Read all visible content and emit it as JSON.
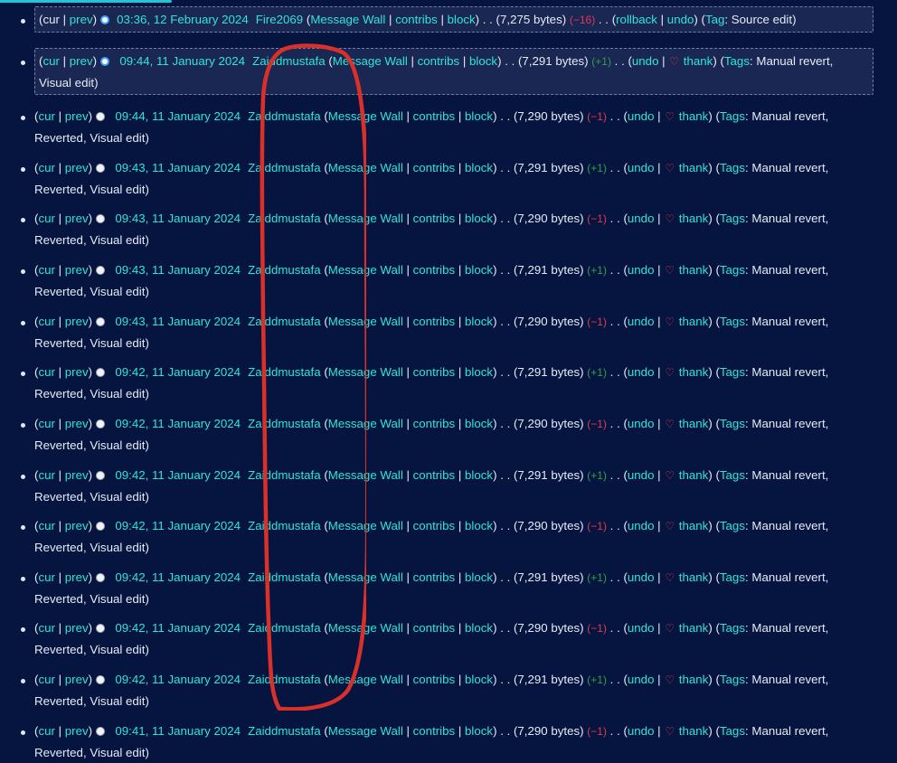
{
  "labels": {
    "cur": "cur",
    "prev": "prev",
    "message_wall": "Message Wall",
    "contribs": "contribs",
    "block": "block",
    "rollback": "rollback",
    "undo": "undo",
    "thank": "thank",
    "tag": "Tag",
    "tags": "Tags",
    "heart_icon": "heart-icon"
  },
  "history": [
    {
      "cur_link": false,
      "prev_link": true,
      "radio_selected": true,
      "timestamp": "03:36, 12 February 2024",
      "user": "Fire2069",
      "bytes": "(7,275 bytes)",
      "diff": "(−16)",
      "diff_sign": "neg",
      "rollback": true,
      "thank": false,
      "tag_label": "Tag",
      "tags": "Source edit",
      "boxed": true
    },
    {
      "cur_link": true,
      "prev_link": true,
      "radio_selected": true,
      "timestamp": "09:44, 11 January 2024",
      "user": "Zaiddmustafa",
      "bytes": "(7,291 bytes)",
      "diff": "(+1)",
      "diff_sign": "pos",
      "rollback": false,
      "thank": true,
      "tag_label": "Tags",
      "tags": "Manual revert, Visual edit",
      "boxed": true
    },
    {
      "cur_link": true,
      "prev_link": true,
      "radio_selected": false,
      "timestamp": "09:44, 11 January 2024",
      "user": "Zaiddmustafa",
      "bytes": "(7,290 bytes)",
      "diff": "(−1)",
      "diff_sign": "neg",
      "rollback": false,
      "thank": true,
      "tag_label": "Tags",
      "tags": "Manual revert, Reverted, Visual edit",
      "boxed": false
    },
    {
      "cur_link": true,
      "prev_link": true,
      "radio_selected": false,
      "timestamp": "09:43, 11 January 2024",
      "user": "Zaiddmustafa",
      "bytes": "(7,291 bytes)",
      "diff": "(+1)",
      "diff_sign": "pos",
      "rollback": false,
      "thank": true,
      "tag_label": "Tags",
      "tags": "Manual revert, Reverted, Visual edit",
      "boxed": false
    },
    {
      "cur_link": true,
      "prev_link": true,
      "radio_selected": false,
      "timestamp": "09:43, 11 January 2024",
      "user": "Zaiddmustafa",
      "bytes": "(7,290 bytes)",
      "diff": "(−1)",
      "diff_sign": "neg",
      "rollback": false,
      "thank": true,
      "tag_label": "Tags",
      "tags": "Manual revert, Reverted, Visual edit",
      "boxed": false
    },
    {
      "cur_link": true,
      "prev_link": true,
      "radio_selected": false,
      "timestamp": "09:43, 11 January 2024",
      "user": "Zaiddmustafa",
      "bytes": "(7,291 bytes)",
      "diff": "(+1)",
      "diff_sign": "pos",
      "rollback": false,
      "thank": true,
      "tag_label": "Tags",
      "tags": "Manual revert, Reverted, Visual edit",
      "boxed": false
    },
    {
      "cur_link": true,
      "prev_link": true,
      "radio_selected": false,
      "timestamp": "09:43, 11 January 2024",
      "user": "Zaiddmustafa",
      "bytes": "(7,290 bytes)",
      "diff": "(−1)",
      "diff_sign": "neg",
      "rollback": false,
      "thank": true,
      "tag_label": "Tags",
      "tags": "Manual revert, Reverted, Visual edit",
      "boxed": false
    },
    {
      "cur_link": true,
      "prev_link": true,
      "radio_selected": false,
      "timestamp": "09:42, 11 January 2024",
      "user": "Zaiddmustafa",
      "bytes": "(7,291 bytes)",
      "diff": "(+1)",
      "diff_sign": "pos",
      "rollback": false,
      "thank": true,
      "tag_label": "Tags",
      "tags": "Manual revert, Reverted, Visual edit",
      "boxed": false
    },
    {
      "cur_link": true,
      "prev_link": true,
      "radio_selected": false,
      "timestamp": "09:42, 11 January 2024",
      "user": "Zaiddmustafa",
      "bytes": "(7,290 bytes)",
      "diff": "(−1)",
      "diff_sign": "neg",
      "rollback": false,
      "thank": true,
      "tag_label": "Tags",
      "tags": "Manual revert, Reverted, Visual edit",
      "boxed": false
    },
    {
      "cur_link": true,
      "prev_link": true,
      "radio_selected": false,
      "timestamp": "09:42, 11 January 2024",
      "user": "Zaiddmustafa",
      "bytes": "(7,291 bytes)",
      "diff": "(+1)",
      "diff_sign": "pos",
      "rollback": false,
      "thank": true,
      "tag_label": "Tags",
      "tags": "Manual revert, Reverted, Visual edit",
      "boxed": false
    },
    {
      "cur_link": true,
      "prev_link": true,
      "radio_selected": false,
      "timestamp": "09:42, 11 January 2024",
      "user": "Zaiddmustafa",
      "bytes": "(7,290 bytes)",
      "diff": "(−1)",
      "diff_sign": "neg",
      "rollback": false,
      "thank": true,
      "tag_label": "Tags",
      "tags": "Manual revert, Reverted, Visual edit",
      "boxed": false
    },
    {
      "cur_link": true,
      "prev_link": true,
      "radio_selected": false,
      "timestamp": "09:42, 11 January 2024",
      "user": "Zaiddmustafa",
      "bytes": "(7,291 bytes)",
      "diff": "(+1)",
      "diff_sign": "pos",
      "rollback": false,
      "thank": true,
      "tag_label": "Tags",
      "tags": "Manual revert, Reverted, Visual edit",
      "boxed": false
    },
    {
      "cur_link": true,
      "prev_link": true,
      "radio_selected": false,
      "timestamp": "09:42, 11 January 2024",
      "user": "Zaiddmustafa",
      "bytes": "(7,290 bytes)",
      "diff": "(−1)",
      "diff_sign": "neg",
      "rollback": false,
      "thank": true,
      "tag_label": "Tags",
      "tags": "Manual revert, Reverted, Visual edit",
      "boxed": false
    },
    {
      "cur_link": true,
      "prev_link": true,
      "radio_selected": false,
      "timestamp": "09:42, 11 January 2024",
      "user": "Zaiddmustafa",
      "bytes": "(7,291 bytes)",
      "diff": "(+1)",
      "diff_sign": "pos",
      "rollback": false,
      "thank": true,
      "tag_label": "Tags",
      "tags": "Manual revert, Reverted, Visual edit",
      "boxed": false
    },
    {
      "cur_link": true,
      "prev_link": true,
      "radio_selected": false,
      "timestamp": "09:41, 11 January 2024",
      "user": "Zaiddmustafa",
      "bytes": "(7,290 bytes)",
      "diff": "(−1)",
      "diff_sign": "neg",
      "rollback": false,
      "thank": true,
      "tag_label": "Tags",
      "tags": "Manual revert, Reverted, Visual edit",
      "boxed": false
    }
  ],
  "colors": {
    "background": "#061540",
    "link": "#2fe5d5",
    "text": "#e6ebf5",
    "negative": "#e03b4f",
    "positive": "#2ea24a",
    "annotation": "#d9302a",
    "accent": "#20c5d8"
  }
}
